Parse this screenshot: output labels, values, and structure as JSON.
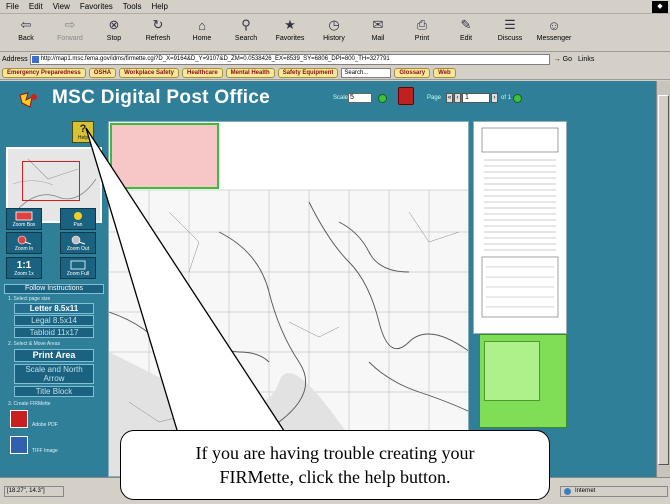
{
  "browser": {
    "menu": [
      "File",
      "Edit",
      "View",
      "Favorites",
      "Tools",
      "Help"
    ],
    "toolbar": [
      {
        "label": "Back",
        "icon": "back-arrow-icon",
        "enabled": true
      },
      {
        "label": "Forward",
        "icon": "forward-arrow-icon",
        "enabled": false
      },
      {
        "label": "Stop",
        "icon": "stop-icon",
        "enabled": true
      },
      {
        "label": "Refresh",
        "icon": "refresh-icon",
        "enabled": true
      },
      {
        "label": "Home",
        "icon": "home-icon",
        "enabled": true
      },
      {
        "label": "Search",
        "icon": "search-icon",
        "enabled": true
      },
      {
        "label": "Favorites",
        "icon": "favorites-icon",
        "enabled": true
      },
      {
        "label": "History",
        "icon": "history-icon",
        "enabled": true
      },
      {
        "label": "Mail",
        "icon": "mail-icon",
        "enabled": true
      },
      {
        "label": "Print",
        "icon": "print-icon",
        "enabled": true
      },
      {
        "label": "Edit",
        "icon": "edit-icon",
        "enabled": true
      },
      {
        "label": "Discuss",
        "icon": "discuss-icon",
        "enabled": true
      },
      {
        "label": "Messenger",
        "icon": "messenger-icon",
        "enabled": true
      }
    ],
    "address_label": "Address",
    "address_url": "http://map1.msc.fema.gov/idms/firmette.cgi?D_X=9164&D_Y=9107&D_ZM=0.0538426_EX=8539_SY=6806_DPI=800_TH=327791",
    "go_label": "Go",
    "links_label": "Links",
    "links": [
      "Emergency Preparedness",
      "OSHA",
      "Workplace Safety",
      "Healthcare",
      "Mental Health",
      "Safety Equipment"
    ],
    "search_placeholder": "Search...",
    "links_right": [
      "Glossary",
      "Web"
    ]
  },
  "app": {
    "title": "MSC Digital Post Office",
    "scale_label": "Scale",
    "scale_value": "5",
    "page_label": "Page",
    "page_value": "1",
    "page_of": "of",
    "page_total": "1",
    "help_label": "Help"
  },
  "tools": {
    "zoom_box": "Zoom Box",
    "pan": "Pan",
    "zoom_in": "Zoom In",
    "zoom_out": "Zoom Out",
    "zoom_1to1": "Zoom 1x",
    "zoom_full": "Zoom Full",
    "one_to_one": "1:1"
  },
  "instructions": {
    "follow": "Follow Instructions",
    "step1": "1. Select page size",
    "sizes": [
      "Letter 8.5x11",
      "Legal 8.5x14",
      "Tabloid 11x17"
    ],
    "selected_size_index": 0,
    "step2": "2. Select & Move Areas",
    "print_area": "Print Area",
    "scale_north": "Scale and North Arrow",
    "title_block": "Title Block",
    "step3": "3. Create FIRMette",
    "export": [
      {
        "label": "Adobe PDF",
        "icon": "pdf-icon",
        "color": "#c82020"
      },
      {
        "label": "TIFF Image",
        "icon": "tiff-icon",
        "color": "#3060b0"
      }
    ]
  },
  "status": {
    "coords": "[18.27\", 14.3\"]",
    "zone": "Internet"
  },
  "callout": {
    "line1": "If you are having trouble creating your",
    "line2": "FIRMette, click the help button."
  },
  "colors": {
    "page_bg": "#2f7f99",
    "print_area_fill": "#f7c7c7",
    "selection_border": "#37c037",
    "title_block_fill": "#7fde56"
  }
}
